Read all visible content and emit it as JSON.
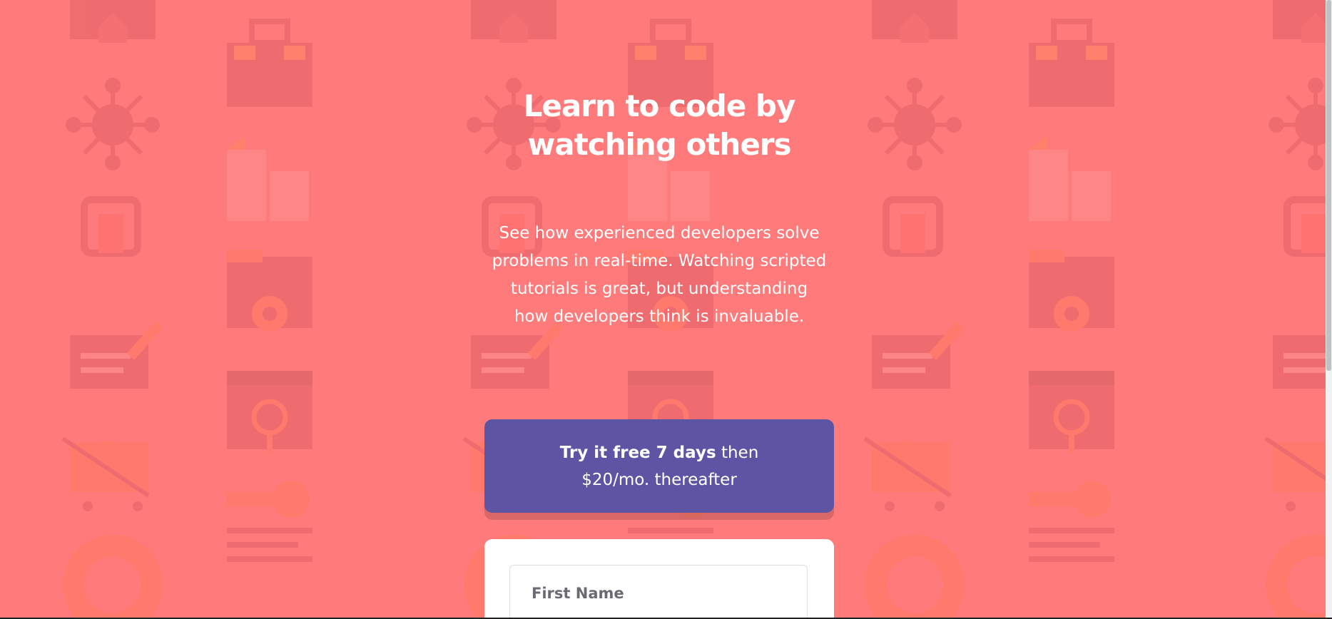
{
  "colors": {
    "background": "#ff7a7a",
    "banner": "#5e54a4",
    "card": "#ffffff",
    "text": "#ffffff"
  },
  "hero": {
    "headline_line1": "Learn to code by",
    "headline_line2": "watching others",
    "description": "See how experienced developers solve problems in real-time. Watching scripted tutorials is great, but understanding how developers think is invaluable."
  },
  "trial": {
    "bold": "Try it free 7 days",
    "rest_line1": " then",
    "line2": "$20/mo. thereafter"
  },
  "form": {
    "first_name_placeholder": "First Name"
  }
}
